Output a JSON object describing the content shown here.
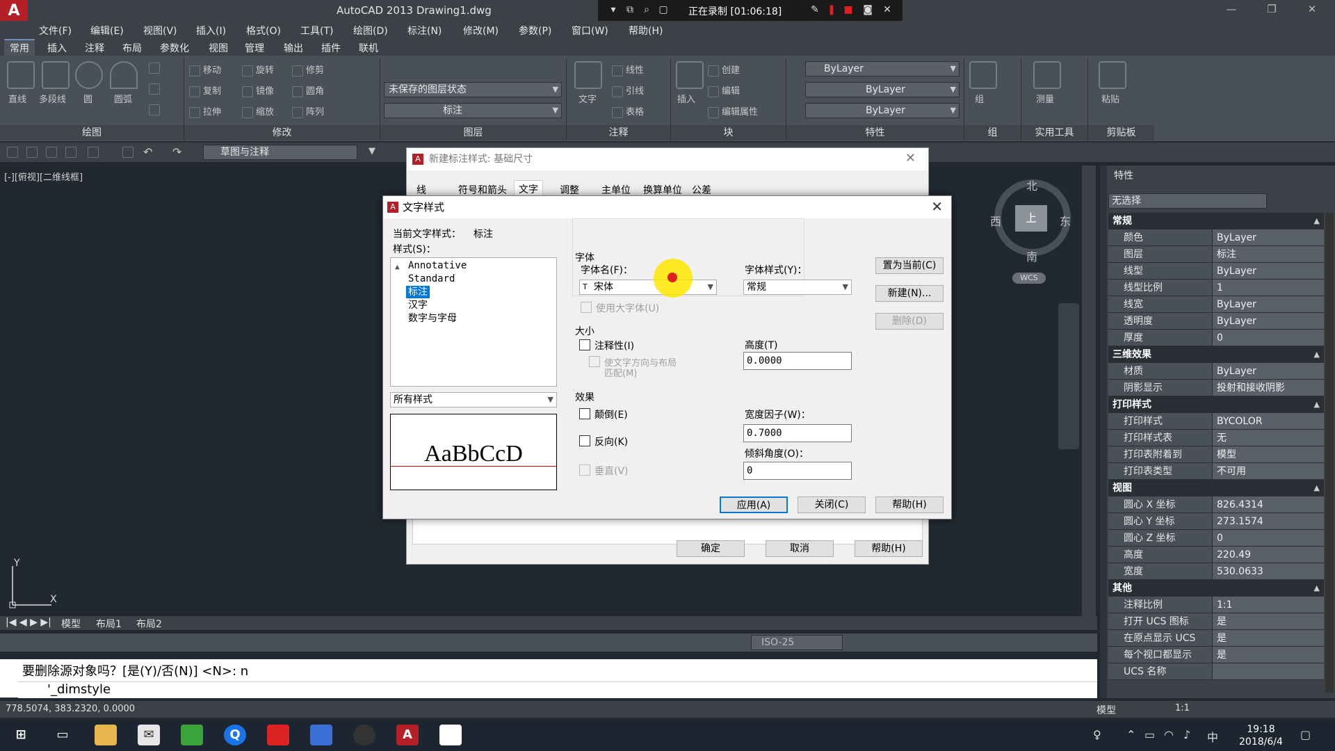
{
  "titlebar": {
    "app_title": "AutoCAD 2013    Drawing1.dwg",
    "recording_status": "正在录制 [01:06:18]",
    "logo": "A"
  },
  "menu": [
    "文件(F)",
    "编辑(E)",
    "视图(V)",
    "插入(I)",
    "格式(O)",
    "工具(T)",
    "绘图(D)",
    "标注(N)",
    "修改(M)",
    "参数(P)",
    "窗口(W)",
    "帮助(H)"
  ],
  "ribbon_tabs": [
    "常用",
    "插入",
    "注释",
    "布局",
    "参数化",
    "视图",
    "管理",
    "输出",
    "插件",
    "联机"
  ],
  "ribbon": {
    "panels": [
      "绘图",
      "修改",
      "图层",
      "注释",
      "块",
      "特性",
      "组",
      "实用工具",
      "剪贴板"
    ],
    "draw_tools": [
      "直线",
      "多段线",
      "圆",
      "圆弧"
    ],
    "modify_tools": [
      "移动",
      "旋转",
      "修剪",
      "复制",
      "镜像",
      "圆角",
      "拉伸",
      "缩放",
      "阵列"
    ],
    "layer_state": "未保存的图层状态",
    "layer_current": "标注",
    "annotation_big": "文字",
    "annotation_tools": [
      "线性",
      "引线",
      "表格"
    ],
    "block_insert": "插入",
    "block_tools": [
      "创建",
      "编辑",
      "编辑属性"
    ],
    "prop_color": "ByLayer",
    "prop_linetype": "ByLayer",
    "prop_lineweight": "ByLayer",
    "group_label": "组",
    "measure_label": "测量",
    "paste_label": "粘贴"
  },
  "qat": {
    "workspace": "草图与注释"
  },
  "viewport": {
    "label": "[-][俯视][二维线框]",
    "compass": {
      "north": "北",
      "south": "南",
      "east": "东",
      "west": "西",
      "top": "上",
      "wcs": "WCS"
    },
    "ucs_y": "Y",
    "ucs_x": "X"
  },
  "layout_tabs": [
    "模型",
    "布局1",
    "布局2"
  ],
  "bottom_toolbar": {
    "dimstyle": "ISO-25"
  },
  "command": {
    "history": "要删除源对象吗？[是(Y)/否(N)] <N>: n",
    "input": "'_dimstyle"
  },
  "status": {
    "coords": "778.5074, 383.2320, 0.0000",
    "model": "模型",
    "scale": "1:1"
  },
  "taskbar": {
    "time": "19:18",
    "date": "2018/6/4",
    "ime": "中"
  },
  "properties": {
    "title": "特性",
    "selection": "无选择",
    "sections": [
      {
        "name": "常规",
        "rows": [
          [
            "颜色",
            "ByLayer"
          ],
          [
            "图层",
            "标注"
          ],
          [
            "线型",
            "ByLayer"
          ],
          [
            "线型比例",
            "1"
          ],
          [
            "线宽",
            "ByLayer"
          ],
          [
            "透明度",
            "ByLayer"
          ],
          [
            "厚度",
            "0"
          ]
        ]
      },
      {
        "name": "三维效果",
        "rows": [
          [
            "材质",
            "ByLayer"
          ],
          [
            "阴影显示",
            "投射和接收阴影"
          ]
        ]
      },
      {
        "name": "打印样式",
        "rows": [
          [
            "打印样式",
            "BYCOLOR"
          ],
          [
            "打印样式表",
            "无"
          ],
          [
            "打印表附着到",
            "模型"
          ],
          [
            "打印表类型",
            "不可用"
          ]
        ]
      },
      {
        "name": "视图",
        "rows": [
          [
            "圆心 X 坐标",
            "826.4314"
          ],
          [
            "圆心 Y 坐标",
            "273.1574"
          ],
          [
            "圆心 Z 坐标",
            "0"
          ],
          [
            "高度",
            "220.49"
          ],
          [
            "宽度",
            "530.0633"
          ]
        ]
      },
      {
        "name": "其他",
        "rows": [
          [
            "注释比例",
            "1:1"
          ],
          [
            "打开 UCS 图标",
            "是"
          ],
          [
            "在原点显示 UCS",
            "是"
          ],
          [
            "每个视口都显示",
            "是"
          ],
          [
            "UCS 名称",
            ""
          ]
        ]
      }
    ]
  },
  "dimstyle_dialog": {
    "title": "新建标注样式: 基础尺寸",
    "tabs": [
      "线",
      "符号和箭头",
      "文字",
      "调整",
      "主单位",
      "换算单位",
      "公差"
    ],
    "buttons": [
      "确定",
      "取消",
      "帮助(H)"
    ]
  },
  "textstyle_dialog": {
    "title": "文字样式",
    "current_label": "当前文字样式：",
    "current_value": "标注",
    "styles_label": "样式(S)：",
    "styles": [
      "Annotative",
      "Standard",
      "标注",
      "汉字",
      "数字与字母"
    ],
    "selected_style": "标注",
    "filter": "所有样式",
    "preview_text": "AaBbCcD",
    "font_group": "字体",
    "font_name_label": "字体名(F)：",
    "font_name": "宋体",
    "font_style_label": "字体样式(Y)：",
    "font_style": "常规",
    "bigfont_label": "使用大字体(U)",
    "size_group": "大小",
    "annotative_label": "注释性(I)",
    "match_layout_label": "使文字方向与布局",
    "match_layout_label2": "匹配(M)",
    "height_label": "高度(T)",
    "height": "0.0000",
    "effects_group": "效果",
    "upside_down_label": "颠倒(E)",
    "backwards_label": "反向(K)",
    "vertical_label": "垂直(V)",
    "width_label": "宽度因子(W)：",
    "width": "0.7000",
    "oblique_label": "倾斜角度(O)：",
    "oblique": "0",
    "btn_set_current": "置为当前(C)",
    "btn_new": "新建(N)...",
    "btn_delete": "删除(D)",
    "btn_apply": "应用(A)",
    "btn_close": "关闭(C)",
    "btn_help": "帮助(H)"
  }
}
